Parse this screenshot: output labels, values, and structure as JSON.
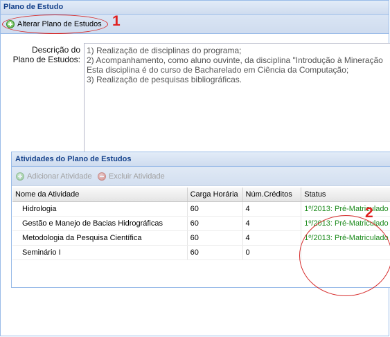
{
  "panel": {
    "title": "Plano de Estudo"
  },
  "toolbar": {
    "alterar_label": "Alterar Plano de Estudos",
    "alterar_icon": "add-icon"
  },
  "annotations": {
    "one": "1",
    "two": "2",
    "color": "#d62a2a"
  },
  "description": {
    "label_line1": "Descrição do",
    "label_line2": "Plano de Estudos:",
    "lines": [
      "1) Realização de disciplinas do programa;",
      "2) Acompanhamento, como aluno ouvinte, da disciplina \"Introdução à Mineração",
      "Esta disciplina é do curso de Bacharelado em Ciência da Computação;",
      "3) Realização de pesquisas bibliográficas."
    ]
  },
  "activities": {
    "title": "Atividades do Plano de Estudos",
    "add_label": "Adicionar Atividade",
    "delete_label": "Excluir Atividade",
    "columns": [
      "Nome da Atividade",
      "Carga Horária",
      "Núm.Créditos",
      "Status"
    ],
    "rows": [
      [
        "Hidrologia",
        "60",
        "4",
        "1º/2013: Pré-Matriculado"
      ],
      [
        "Gestão e Manejo de Bacias Hidrográficas",
        "60",
        "4",
        "1º/2013: Pré-Matriculado"
      ],
      [
        "Metodologia da Pesquisa Científica",
        "60",
        "4",
        "1º/2013: Pré-Matriculado"
      ],
      [
        "Seminário I",
        "60",
        "0",
        ""
      ]
    ],
    "status_color": "#1a8a1a"
  },
  "theme": {
    "header_text": "#15428b",
    "border": "#99bbe8",
    "panel_bg": "#dfe8f6"
  }
}
